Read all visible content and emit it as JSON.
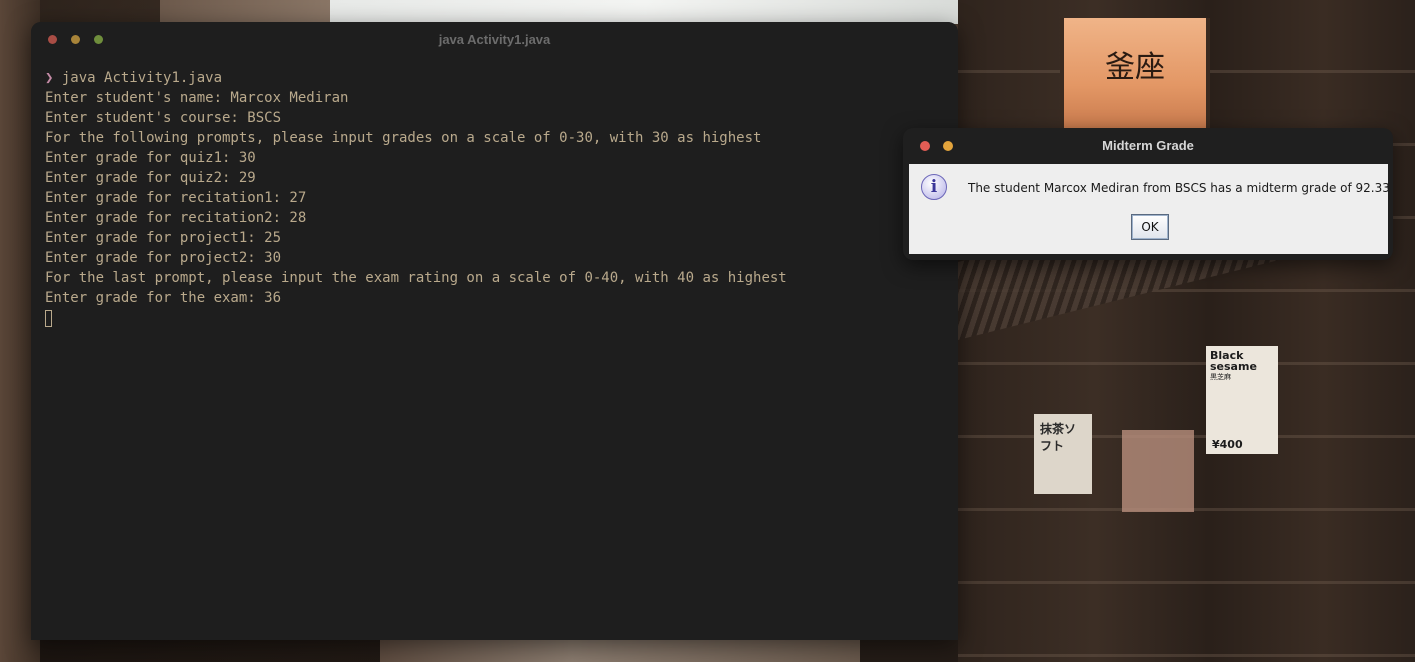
{
  "wallpaper": {
    "lantern_text": "釜座",
    "sign_title": "Black sesame",
    "sign_sub": "黒芝麻",
    "sign_price": "¥400",
    "poster_text": "抹茶ソフト"
  },
  "terminal": {
    "title": "java Activity1.java",
    "prompt_symbol": "❯",
    "command": " java Activity1.java",
    "lines": [
      "Enter student's name: Marcox Mediran",
      "Enter student's course: BSCS",
      "For the following prompts, please input grades on a scale of 0-30, with 30 as highest",
      "Enter grade for quiz1: 30",
      "Enter grade for quiz2: 29",
      "Enter grade for recitation1: 27",
      "Enter grade for recitation2: 28",
      "Enter grade for project1: 25",
      "Enter grade for project2: 30",
      "For the last prompt, please input the exam rating on a scale of 0-40, with 40 as highest",
      "Enter grade for the exam: 36"
    ],
    "colors": {
      "background": "#1e1e1e",
      "text": "#b9a98c",
      "prompt": "#c48ba6"
    }
  },
  "dialog": {
    "title": "Midterm Grade",
    "icon": "info-icon",
    "icon_glyph": "i",
    "message": "The student Marcox Mediran from BSCS has a midterm grade of 92.33",
    "ok_label": "OK"
  }
}
